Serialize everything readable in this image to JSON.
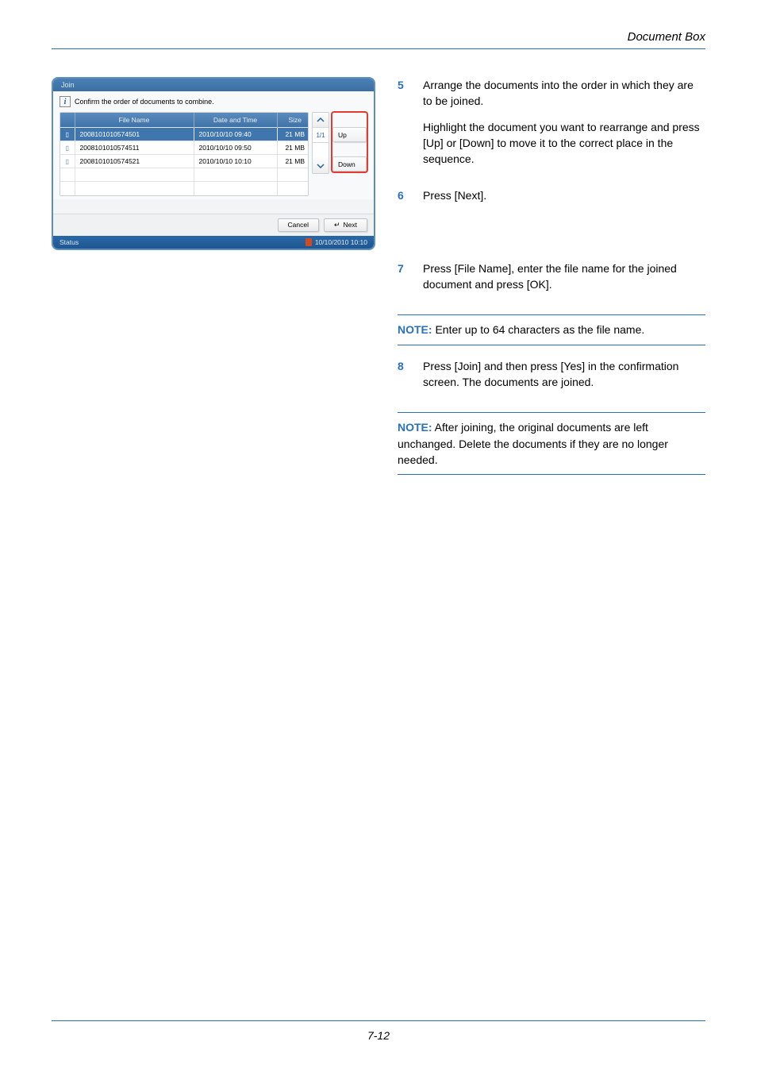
{
  "header": {
    "title": "Document Box"
  },
  "panel": {
    "title": "Join",
    "info": "Confirm the order of documents to combine.",
    "columns": {
      "name": "File Name",
      "date": "Date and Time",
      "size": "Size"
    },
    "rows": [
      {
        "name": "2008101010574501",
        "date": "2010/10/10  09:40",
        "size": "21 MB",
        "selected": true
      },
      {
        "name": "2008101010574511",
        "date": "2010/10/10  09:50",
        "size": "21 MB",
        "selected": false
      },
      {
        "name": "2008101010574521",
        "date": "2010/10/10  10:10",
        "size": "21 MB",
        "selected": false
      }
    ],
    "pager": "1/1",
    "up_label": "Up",
    "down_label": "Down",
    "cancel_label": "Cancel",
    "next_label": "Next",
    "status_label": "Status",
    "status_time": "10/10/2010   10:10"
  },
  "steps": {
    "s5": {
      "num": "5",
      "p1": "Arrange the documents into the order in which they are to be joined.",
      "p2": "Highlight the document you want to rearrange and press [Up] or [Down] to move it to the correct place in the sequence."
    },
    "s6": {
      "num": "6",
      "p1": "Press [Next]."
    },
    "s7": {
      "num": "7",
      "p1": "Press [File Name], enter the file name for the joined document and press [OK]."
    },
    "s8": {
      "num": "8",
      "p1": "Press [Join] and then press [Yes] in the confirmation screen. The documents are joined."
    }
  },
  "notes": {
    "label": "NOTE:",
    "n1": " Enter up to 64 characters as the file name.",
    "n2": " After joining, the original documents are left unchanged. Delete the documents if they are no longer needed."
  },
  "footer": {
    "page": "7-12"
  }
}
